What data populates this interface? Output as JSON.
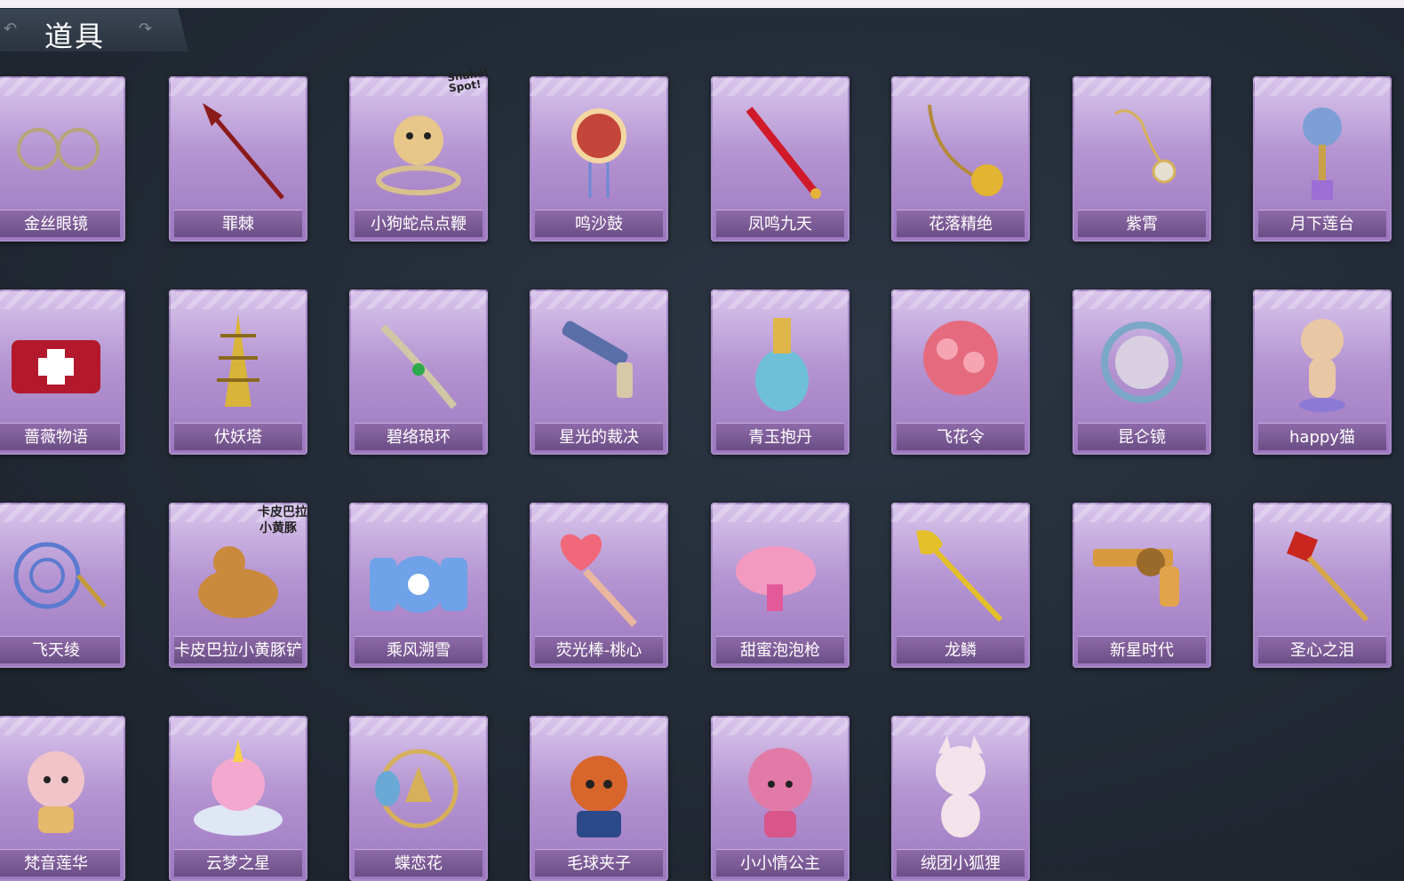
{
  "header": {
    "title": "道具"
  },
  "items": [
    {
      "name": "金丝眼镜",
      "icon": "glasses-icon",
      "color": "#b8a47a"
    },
    {
      "name": "罪棘",
      "icon": "spear-icon",
      "color": "#8b1a1a"
    },
    {
      "name": "小狗蛇点点鞭",
      "icon": "snake-whip-icon",
      "color": "#e7c68a"
    },
    {
      "name": "鸣沙鼓",
      "icon": "drum-icon",
      "color": "#c4463a"
    },
    {
      "name": "凤鸣九天",
      "icon": "red-sword-icon",
      "color": "#d01a2a"
    },
    {
      "name": "花落精绝",
      "icon": "flower-chain-icon",
      "color": "#e2b431"
    },
    {
      "name": "紫霄",
      "icon": "pendant-icon",
      "color": "#d7b15a"
    },
    {
      "name": "月下莲台",
      "icon": "lotus-scepter-icon",
      "color": "#7d9fd6"
    },
    {
      "name": "蔷薇物语",
      "icon": "medkit-icon",
      "color": "#b3182c"
    },
    {
      "name": "伏妖塔",
      "icon": "pagoda-icon",
      "color": "#d9b43a"
    },
    {
      "name": "碧络琅环",
      "icon": "jade-blade-icon",
      "color": "#cfc7a5"
    },
    {
      "name": "星光的裁决",
      "icon": "pistol-icon",
      "color": "#5a6ea8"
    },
    {
      "name": "青玉抱丹",
      "icon": "vase-icon",
      "color": "#6ec0d8"
    },
    {
      "name": "飞花令",
      "icon": "flower-ball-icon",
      "color": "#e56a7e"
    },
    {
      "name": "昆仑镜",
      "icon": "mirror-icon",
      "color": "#7aa8c6"
    },
    {
      "name": "happy猫",
      "icon": "cat-icon",
      "color": "#e8c7a5"
    },
    {
      "name": "飞天绫",
      "icon": "ribbon-icon",
      "color": "#5b7ad0"
    },
    {
      "name": "卡皮巴拉小黄豚铲",
      "icon": "capybara-icon",
      "color": "#c98a3e"
    },
    {
      "name": "乘风溯雪",
      "icon": "snow-lantern-icon",
      "color": "#6fa2e8"
    },
    {
      "name": "荧光棒-桃心",
      "icon": "heart-wand-icon",
      "color": "#f0687a"
    },
    {
      "name": "甜蜜泡泡枪",
      "icon": "bubble-gun-icon",
      "color": "#f29ac0"
    },
    {
      "name": "龙鳞",
      "icon": "shovel-icon",
      "color": "#e3c02a"
    },
    {
      "name": "新星时代",
      "icon": "revolver-icon",
      "color": "#d89a3e"
    },
    {
      "name": "圣心之泪",
      "icon": "gem-scepter-icon",
      "color": "#c8261e"
    },
    {
      "name": "梵音莲华",
      "icon": "doll-icon",
      "color": "#f0c4c8"
    },
    {
      "name": "云梦之星",
      "icon": "unicorn-icon",
      "color": "#f3a8d0"
    },
    {
      "name": "蝶恋花",
      "icon": "butterfly-bell-icon",
      "color": "#d6b05a"
    },
    {
      "name": "毛球夹子",
      "icon": "red-panda-icon",
      "color": "#d8652c"
    },
    {
      "name": "小小情公主",
      "icon": "princess-icon",
      "color": "#e27aa8"
    },
    {
      "name": "绒团小狐狸",
      "icon": "fox-icon",
      "color": "#f2e4ea"
    }
  ],
  "badges": {
    "snake": "Snake! Spot!",
    "capybara_line1": "卡皮巴拉",
    "capybara_line2": "小黄豚"
  }
}
